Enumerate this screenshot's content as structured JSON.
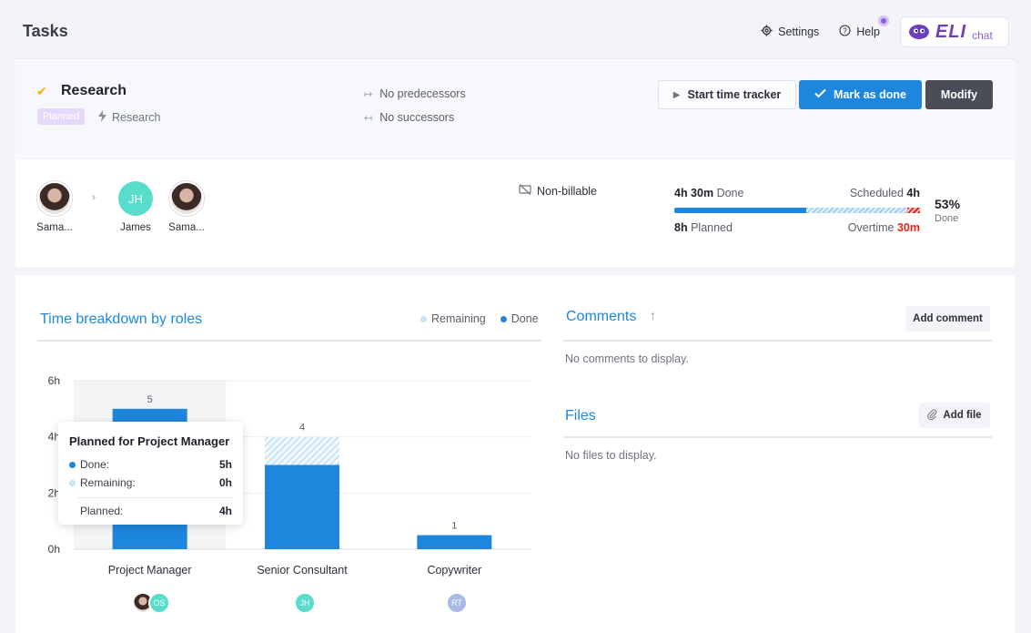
{
  "page": {
    "title": "Tasks"
  },
  "topnav": {
    "settings": "Settings",
    "help": "Help",
    "eli_brand": "ELI",
    "eli_sub": "chat"
  },
  "task": {
    "name": "Research",
    "status": "Planned",
    "project": "Research",
    "predecessors": "No predecessors",
    "successors": "No successors"
  },
  "actions": {
    "start_tracker": "Start time tracker",
    "mark_done": "Mark as done",
    "modify": "Modify"
  },
  "assignees": [
    {
      "label": "Sama...",
      "initials": ""
    },
    {
      "label": "James",
      "initials": "JH"
    },
    {
      "label": "Sama...",
      "initials": ""
    }
  ],
  "billing": "Non-billable",
  "progress": {
    "done_value": "4h 30m",
    "done_label": "Done",
    "scheduled_label": "Scheduled",
    "scheduled_value": "4h",
    "planned_value": "8h",
    "planned_label": "Planned",
    "overtime_label": "Overtime",
    "overtime_value": "30m",
    "percent": "53%",
    "percent_label": "Done",
    "done_fraction": 0.53
  },
  "breakdown": {
    "title": "Time breakdown by roles",
    "legend_remaining": "Remaining",
    "legend_done": "Done"
  },
  "chart_data": {
    "type": "bar",
    "categories": [
      "Project Manager",
      "Senior Consultant",
      "Copywriter"
    ],
    "series": [
      {
        "name": "Done",
        "values": [
          5,
          3,
          0.5
        ]
      },
      {
        "name": "Remaining",
        "values": [
          0,
          1,
          0
        ]
      }
    ],
    "totals": [
      "5",
      "4",
      "1"
    ],
    "ytick_labels": [
      "0h",
      "2h",
      "4h",
      "6h"
    ],
    "ylim": [
      0,
      6
    ],
    "grid": true,
    "legend": "top-right"
  },
  "tooltip": {
    "title": "Planned for Project Manager",
    "done_label": "Done:",
    "done_value": "5h",
    "remaining_label": "Remaining:",
    "remaining_value": "0h",
    "planned_label": "Planned:",
    "planned_value": "4h"
  },
  "roles_avatars": [
    [
      "",
      "OS"
    ],
    [
      "JH"
    ],
    [
      "RT"
    ]
  ],
  "comments": {
    "title": "Comments",
    "add": "Add comment",
    "empty": "No comments to display."
  },
  "files": {
    "title": "Files",
    "add": "Add file",
    "empty": "No files to display."
  },
  "colors": {
    "accent": "#1e86dc",
    "overtime": "#e0251b",
    "remaining": "#9ed0ef",
    "badge": "#e4d8fb"
  }
}
